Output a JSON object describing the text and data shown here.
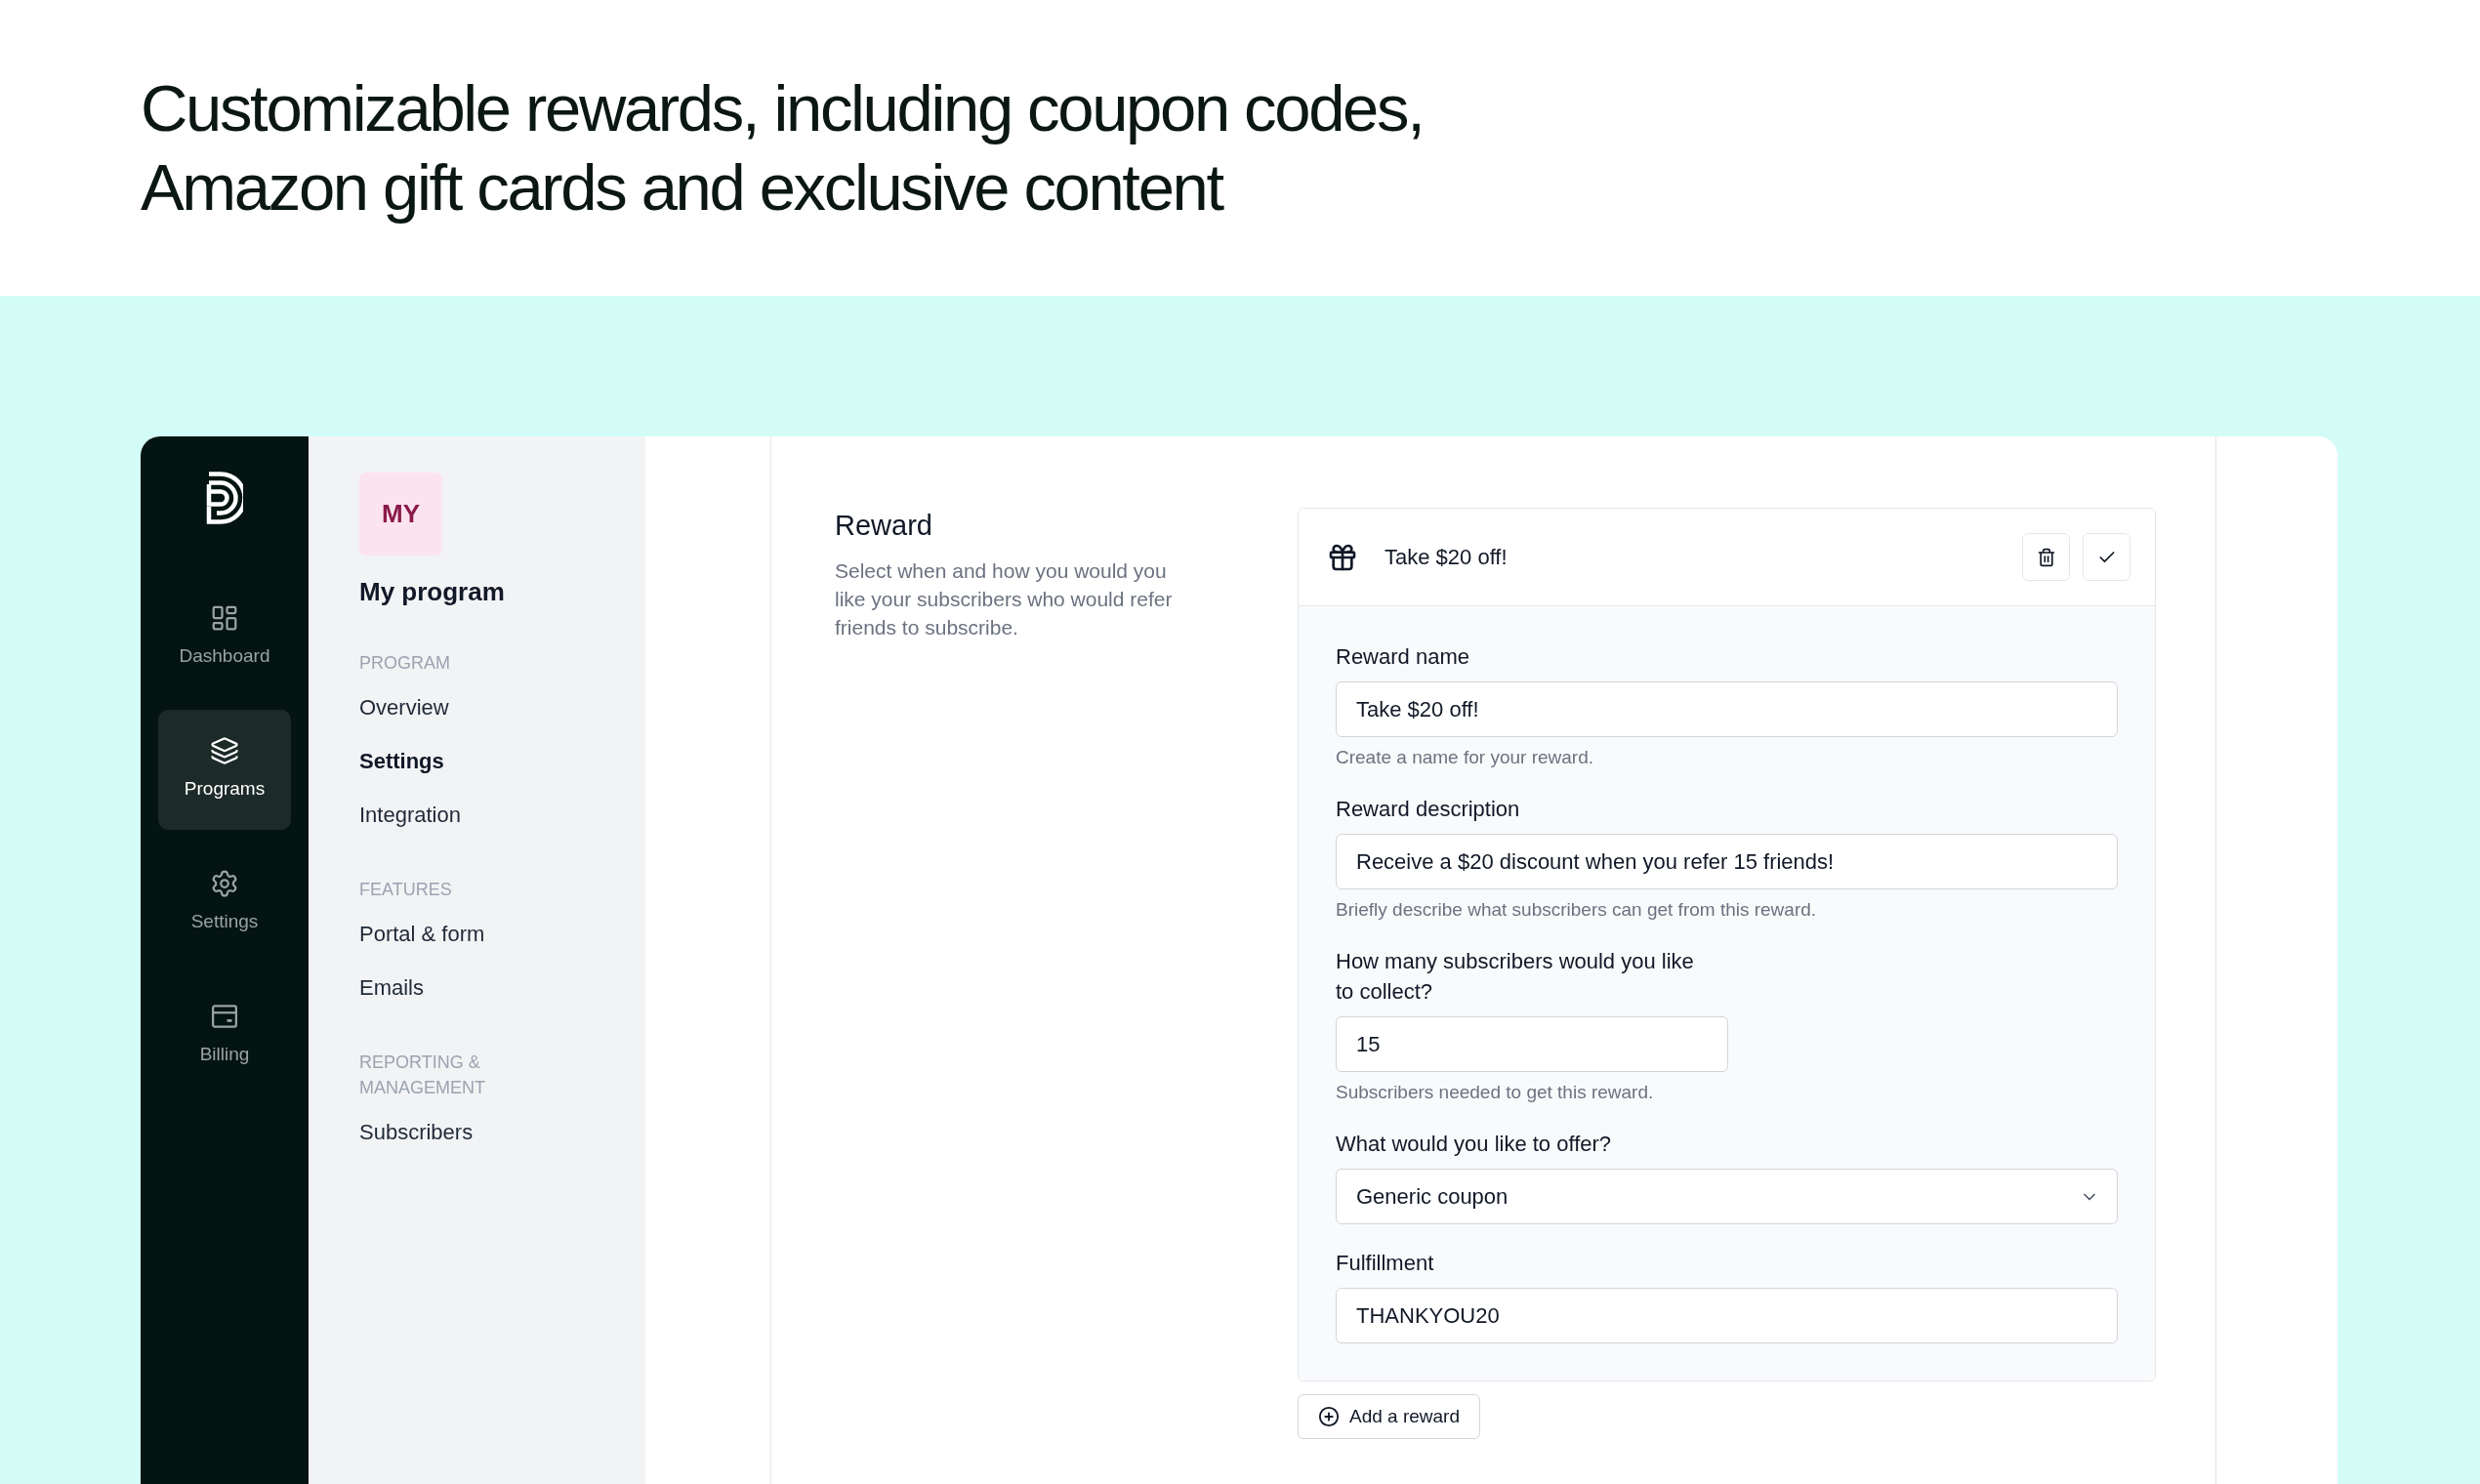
{
  "headline": {
    "lines": [
      "Customizable rewards, including coupon codes,",
      "Amazon gift cards and exclusive content"
    ]
  },
  "app_sidebar": {
    "items": [
      {
        "label": "Dashboard",
        "selected": false
      },
      {
        "label": "Programs",
        "selected": true
      },
      {
        "label": "Settings",
        "selected": false
      },
      {
        "label": "Billing",
        "selected": false
      }
    ]
  },
  "program_nav": {
    "avatar": "MY",
    "name": "My program",
    "sections": [
      {
        "heading": "PROGRAM",
        "items": [
          {
            "label": "Overview",
            "selected": false
          },
          {
            "label": "Settings",
            "selected": true
          },
          {
            "label": "Integration",
            "selected": false
          }
        ]
      },
      {
        "heading": "FEATURES",
        "items": [
          {
            "label": "Portal & form",
            "selected": false
          },
          {
            "label": "Emails",
            "selected": false
          }
        ]
      },
      {
        "heading": "REPORTING & MANAGEMENT",
        "items": [
          {
            "label": "Subscribers",
            "selected": false
          }
        ]
      }
    ]
  },
  "reward_section": {
    "title": "Reward",
    "description": "Select when and how you would you like your subscribers who would refer friends to subscribe."
  },
  "reward_card": {
    "title": "Take $20 off!",
    "fields": [
      {
        "kind": "text",
        "label": "Reward name",
        "value": "Take $20 off!",
        "help": "Create a name for your reward."
      },
      {
        "kind": "text",
        "label": "Reward description",
        "value": "Receive a $20 discount when you refer 15 friends!",
        "help": "Briefly describe what subscribers can get from this reward."
      },
      {
        "kind": "number",
        "label": "How many subscribers would you like to collect?",
        "value": "15",
        "help": "Subscribers needed to get this reward."
      },
      {
        "kind": "select",
        "label": "What would you like to offer?",
        "value": "Generic coupon"
      },
      {
        "kind": "text",
        "label": "Fulfillment",
        "value": "THANKYOU20"
      }
    ]
  },
  "add_button": "Add a reward"
}
